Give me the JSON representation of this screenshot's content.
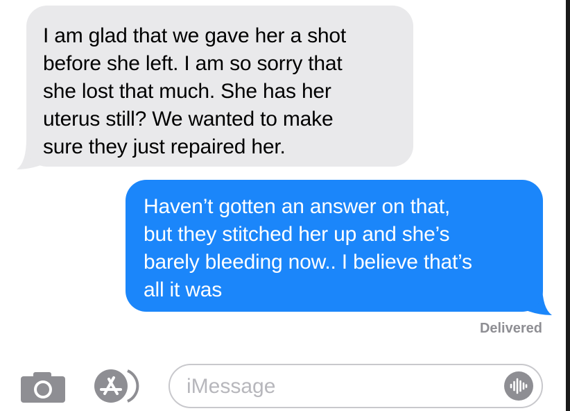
{
  "conversation": {
    "messages": [
      {
        "direction": "incoming",
        "text": "I am glad that we gave her a shot\nbefore she left. I am so sorry that\nshe lost that much. She has her\nuterus still? We wanted to make\nsure they just repaired her."
      },
      {
        "direction": "outgoing",
        "text": "Haven’t gotten an answer on that,\nbut they stitched her up and she’s\nbarely bleeding now.. I believe that’s\nall it was"
      }
    ],
    "delivery_status": "Delivered"
  },
  "composer": {
    "placeholder": "iMessage",
    "icons": {
      "camera": "camera-icon",
      "apps": "app-store-icon",
      "voice": "voice-waveform-icon"
    }
  },
  "colors": {
    "incoming_bubble": "#e9e9eb",
    "outgoing_bubble": "#1b86fa",
    "secondary_text": "#8e8e93"
  }
}
